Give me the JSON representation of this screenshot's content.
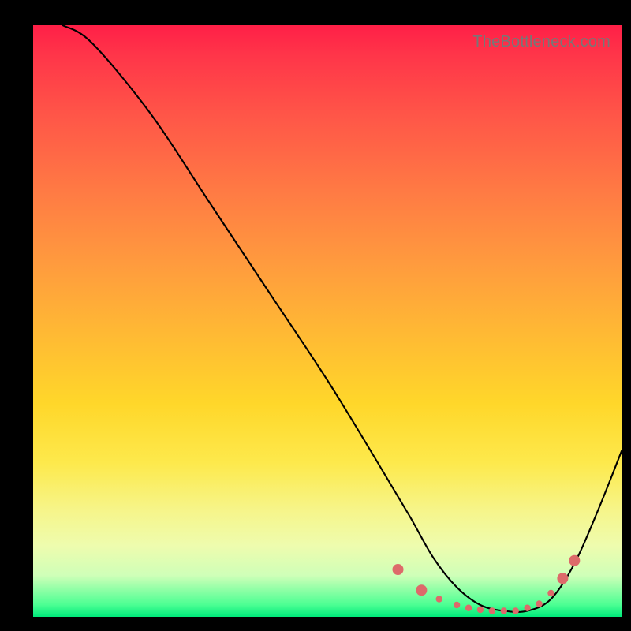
{
  "watermark": "TheBottleneck.com",
  "chart_data": {
    "type": "line",
    "title": "",
    "xlabel": "",
    "ylabel": "",
    "xlim": [
      0,
      100
    ],
    "ylim": [
      0,
      100
    ],
    "series": [
      {
        "name": "curve",
        "x": [
          5,
          10,
          20,
          30,
          40,
          50,
          58,
          64,
          68,
          72,
          76,
          80,
          84,
          88,
          92,
          96,
          100
        ],
        "values": [
          100,
          97,
          85,
          70,
          55,
          40,
          27,
          17,
          10,
          5,
          2,
          1,
          1,
          3,
          9,
          18,
          28
        ]
      }
    ],
    "markers": {
      "name": "highlight-dots",
      "x": [
        62,
        66,
        69,
        72,
        74,
        76,
        78,
        80,
        82,
        84,
        86,
        88,
        90,
        92
      ],
      "values": [
        8,
        4.5,
        3,
        2,
        1.5,
        1.2,
        1,
        1,
        1,
        1.5,
        2.2,
        4,
        6.5,
        9.5
      ]
    }
  }
}
